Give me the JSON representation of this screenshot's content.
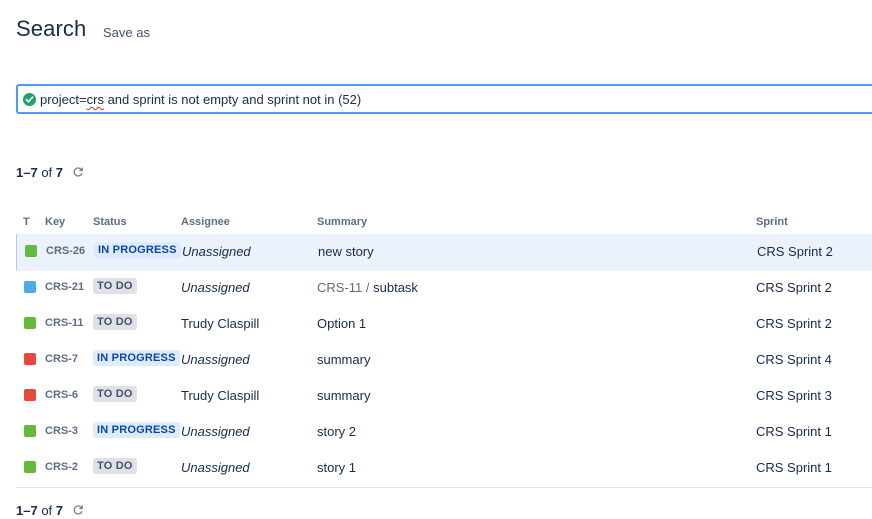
{
  "page": {
    "title": "Search",
    "save_as": "Save as"
  },
  "jql": {
    "prefix": "project=",
    "flagged": "crs",
    "rest": " and sprint is not empty and sprint not in (52)"
  },
  "results": {
    "range": "1–7",
    "of": "of",
    "total": "7"
  },
  "columns": {
    "type": "T",
    "key": "Key",
    "status": "Status",
    "assignee": "Assignee",
    "summary": "Summary",
    "sprint": "Sprint"
  },
  "rows": [
    {
      "type": "story",
      "key": "CRS-26",
      "status": "IN PROGRESS",
      "assignee": "Unassigned",
      "summary": "new story",
      "parent": "",
      "sprint": "CRS Sprint 2"
    },
    {
      "type": "subtask",
      "key": "CRS-21",
      "status": "TO DO",
      "assignee": "Unassigned",
      "summary": "subtask",
      "parent": "CRS-11",
      "sprint": "CRS Sprint 2"
    },
    {
      "type": "story",
      "key": "CRS-11",
      "status": "TO DO",
      "assignee": "Trudy Claspill",
      "summary": "Option 1",
      "parent": "",
      "sprint": "CRS Sprint 2"
    },
    {
      "type": "bug",
      "key": "CRS-7",
      "status": "IN PROGRESS",
      "assignee": "Unassigned",
      "summary": "summary",
      "parent": "",
      "sprint": "CRS Sprint 4"
    },
    {
      "type": "bug",
      "key": "CRS-6",
      "status": "TO DO",
      "assignee": "Trudy Claspill",
      "summary": "summary",
      "parent": "",
      "sprint": "CRS Sprint 3"
    },
    {
      "type": "story",
      "key": "CRS-3",
      "status": "IN PROGRESS",
      "assignee": "Unassigned",
      "summary": "story 2",
      "parent": "",
      "sprint": "CRS Sprint 1"
    },
    {
      "type": "story",
      "key": "CRS-2",
      "status": "TO DO",
      "assignee": "Unassigned",
      "summary": "story 1",
      "parent": "",
      "sprint": "CRS Sprint 1"
    }
  ],
  "colors": {
    "accent": "#4c9aff",
    "story": "#63ba3c",
    "bug": "#e5493a",
    "subtask": "#4bade8",
    "in_progress_bg": "#deebff",
    "todo_bg": "#dfe1e6"
  }
}
